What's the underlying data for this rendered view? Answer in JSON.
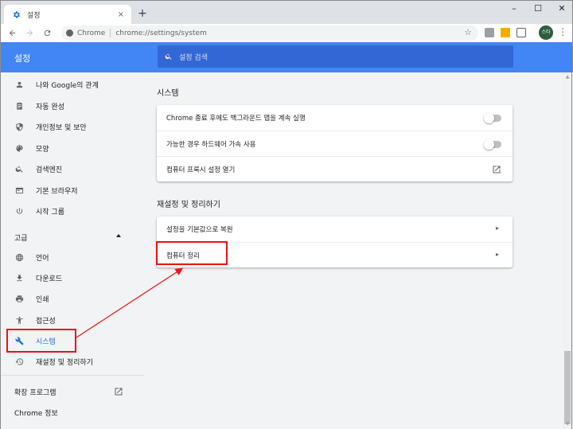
{
  "browser": {
    "tab_title": "설정",
    "tab_close": "×",
    "new_tab": "+",
    "win_min": "–",
    "win_max": "☐",
    "win_close": "✕",
    "omnibox_chip": "Chrome",
    "url": "chrome://settings/system",
    "avatar_text": "스타"
  },
  "header": {
    "title": "설정",
    "search_placeholder": "설정 검색"
  },
  "sidebar": {
    "items": [
      {
        "label": "나와 Google의 관계",
        "icon": "person-icon"
      },
      {
        "label": "자동 완성",
        "icon": "clipboard-icon"
      },
      {
        "label": "개인정보 및 보안",
        "icon": "shield-icon"
      },
      {
        "label": "모양",
        "icon": "palette-icon"
      },
      {
        "label": "검색엔진",
        "icon": "search-icon"
      },
      {
        "label": "기본 브라우저",
        "icon": "browser-icon"
      },
      {
        "label": "시작 그룹",
        "icon": "power-icon"
      }
    ],
    "advanced_label": "고급",
    "advanced_items": [
      {
        "label": "언어",
        "icon": "globe-icon"
      },
      {
        "label": "다운로드",
        "icon": "download-icon"
      },
      {
        "label": "인쇄",
        "icon": "print-icon"
      },
      {
        "label": "접근성",
        "icon": "accessibility-icon"
      },
      {
        "label": "시스템",
        "icon": "wrench-icon"
      },
      {
        "label": "재설정 및 정리하기",
        "icon": "restore-icon"
      }
    ],
    "extensions_label": "확장 프로그램",
    "about_label": "Chrome 정보"
  },
  "main": {
    "system_title": "시스템",
    "system_rows": [
      {
        "label": "Chrome 종료 후에도 백그라운드 앱을 계속 실행",
        "control": "toggle-off"
      },
      {
        "label": "가능한 경우 하드웨어 가속 사용",
        "control": "toggle-off"
      },
      {
        "label": "컴퓨터 프록시 설정 열기",
        "control": "external-link"
      }
    ],
    "reset_title": "재설정 및 정리하기",
    "reset_rows": [
      {
        "label": "설정을 기본값으로 복원",
        "control": "arrow"
      },
      {
        "label": "컴퓨터 정리",
        "control": "arrow"
      }
    ]
  },
  "colors": {
    "header_blue": "#4285f4",
    "search_blue": "#3367d6",
    "active_blue": "#1a73e8",
    "annotation_red": "#e11111"
  }
}
